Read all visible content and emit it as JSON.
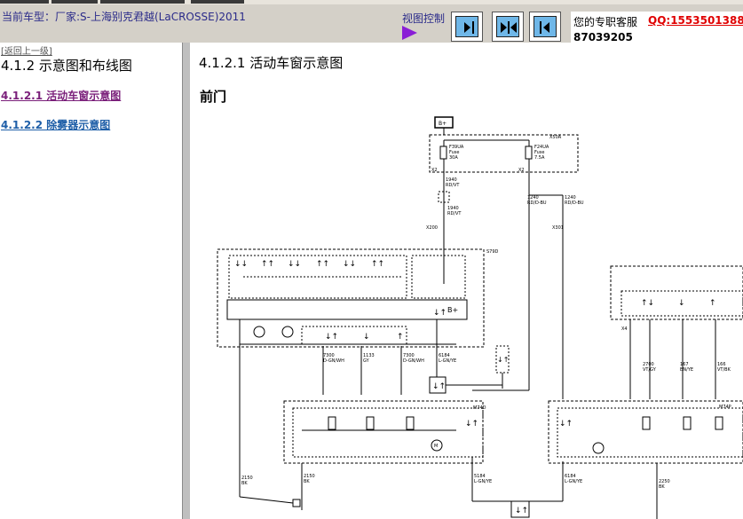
{
  "header": {
    "car_model": "当前车型：厂家:S-上海别克君越(LaCROSSE)2011",
    "view_control_label": "视图控制",
    "view_buttons": [
      "expand-right",
      "split",
      "collapse-left"
    ],
    "support": {
      "text": "您的专职客服",
      "qq": "QQ:1553501388",
      "number": "87039205"
    }
  },
  "sidebar": {
    "back_link": "[返回上一级]",
    "title": "4.1.2 示意图和布线图",
    "links": [
      "4.1.2.1 活动车窗示意图",
      "4.1.2.2 除雾器示意图"
    ]
  },
  "content": {
    "section_title": "4.1.2.1 活动车窗示意图",
    "subsection": "前门",
    "diagram": {
      "fuse_box_label": "X50A\n保险丝盒\n－发动机舱",
      "fuses": [
        {
          "name": "F39UA",
          "type": "Fuse",
          "rating": "30A"
        },
        {
          "name": "F24UA",
          "type": "Fuse",
          "rating": "7.5A"
        }
      ],
      "wires": [
        "1940\nRD/VT",
        "1240\nRD/D-BU",
        "1840\nRD/WH",
        "2150\nBK",
        "5184\nL-GN/YE",
        "6184\nL-GN/YE",
        "7300\nD-GN/WH",
        "1133\nGY",
        "2700\nVT/GY",
        "167\nBN/YE",
        "166\nVT/BK",
        "2250\nBK"
      ],
      "connectors": [
        "X2",
        "X3",
        "X200",
        "X301",
        "X4"
      ],
      "module_labels": [
        "S79D\n车窗开关-驾驶员",
        "S79P\n车窗开关-乘客",
        "M74D\n车窗电机-驾驶员",
        "M74P\n车窗电机-乘客"
      ],
      "fuse_a_pin": "X2",
      "fuse_b_pin": "X2",
      "box_symbol": "B+"
    }
  },
  "colors": {
    "toolbar_bg": "#d4d0c8",
    "accent_purple": "#8a1ed6",
    "button_blue": "#6fb7e8",
    "qq_red": "#e00000",
    "link_visited": "#7a1f7a",
    "link_blue": "#1f5fa8"
  }
}
